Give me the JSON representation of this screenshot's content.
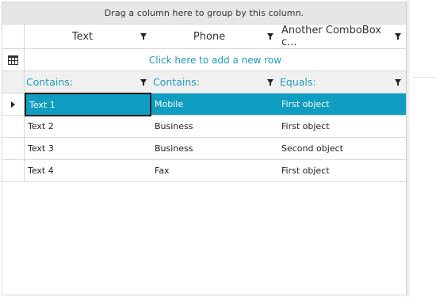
{
  "group_panel": {
    "text": "Drag a column here to group by this column."
  },
  "columns": [
    {
      "label": "Text",
      "filter": "Contains:"
    },
    {
      "label": "Phone",
      "filter": "Contains:"
    },
    {
      "label": "Another ComboBox c...",
      "filter": "Equals:"
    }
  ],
  "new_row": {
    "label": "Click here to add a new row"
  },
  "rows": [
    {
      "text": "Text 1",
      "phone": "Mobile",
      "combo": "First object",
      "selected": true
    },
    {
      "text": "Text 2",
      "phone": "Business",
      "combo": "First object",
      "selected": false
    },
    {
      "text": "Text 3",
      "phone": "Business",
      "combo": "Second object",
      "selected": false
    },
    {
      "text": "Text 4",
      "phone": "Fax",
      "combo": "First object",
      "selected": false
    }
  ],
  "colors": {
    "accent": "#0f9dc1",
    "link": "#1e9bc2",
    "group_panel_bg": "#e6e6e6"
  },
  "icons": {
    "add_row": "table-grid-icon",
    "current_row": "row-indicator-icon",
    "filter": "filter-icon"
  }
}
